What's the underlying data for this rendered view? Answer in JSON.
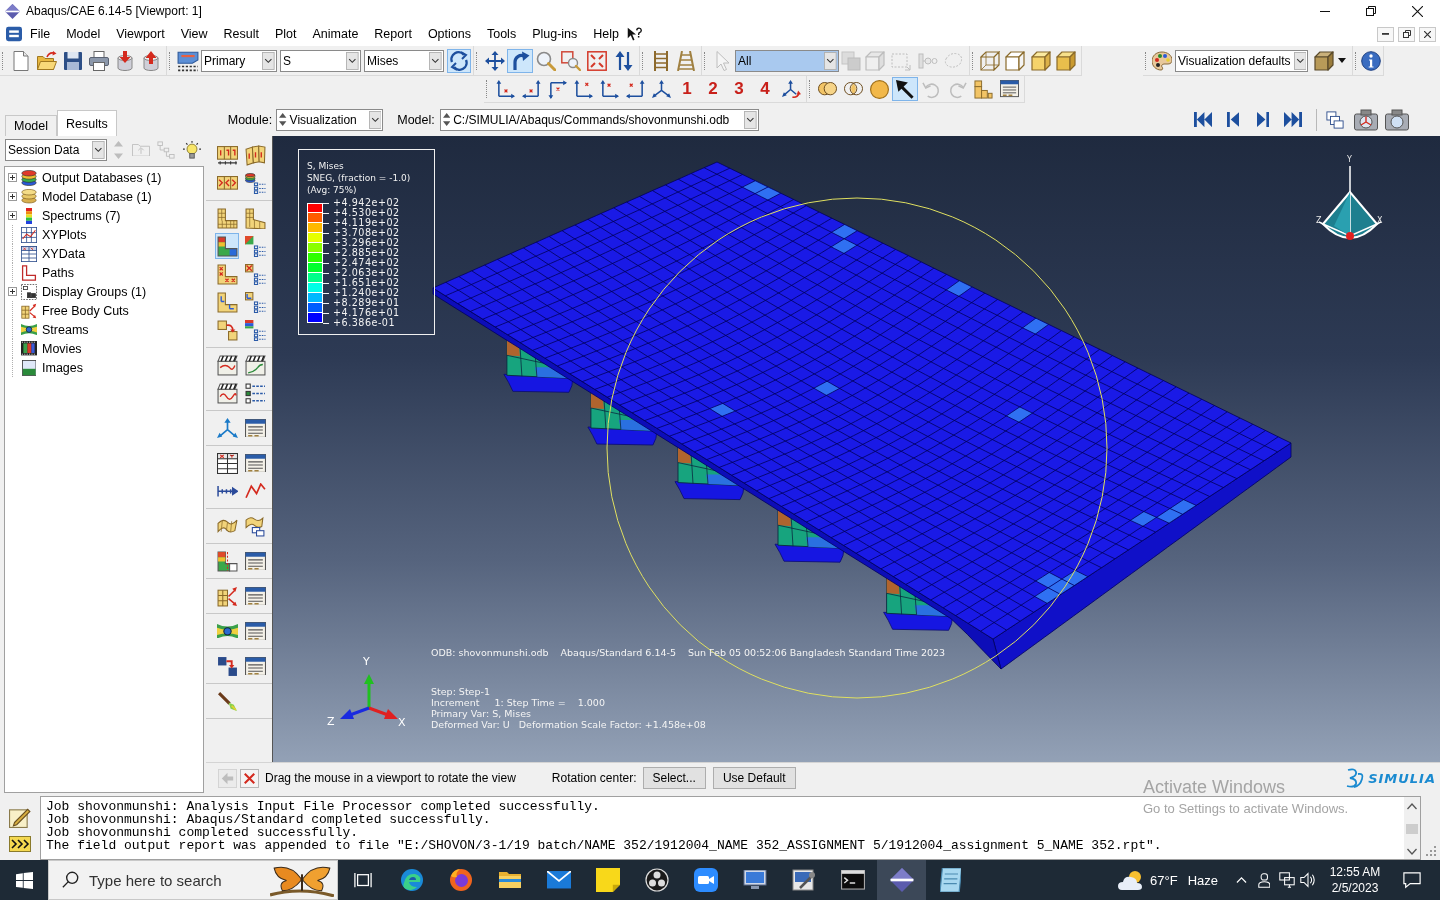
{
  "window": {
    "title": "Abaqus/CAE 6.14-5 [Viewport: 1]"
  },
  "menu": [
    "File",
    "Model",
    "Viewport",
    "View",
    "Result",
    "Plot",
    "Animate",
    "Report",
    "Options",
    "Tools",
    "Plug-ins",
    "Help"
  ],
  "field_output": {
    "variable_type": "Primary",
    "variable": "S",
    "invariant": "Mises",
    "sync_selected": true
  },
  "view_tools": [
    {
      "kind": "pan",
      "selected": false
    },
    {
      "kind": "rotate",
      "selected": true
    },
    {
      "kind": "zoom",
      "selected": false
    },
    {
      "kind": "box-zoom",
      "selected": false
    },
    {
      "kind": "fit",
      "selected": false
    },
    {
      "kind": "flip",
      "selected": false
    }
  ],
  "selection": {
    "filter": "All",
    "tools": [
      {
        "kind": "cursor",
        "disabled": true
      },
      {
        "kind": "stack",
        "disabled": true
      },
      {
        "kind": "cube-select",
        "disabled": true
      },
      {
        "kind": "rect-select",
        "disabled": true
      },
      {
        "kind": "node-select",
        "disabled": true
      },
      {
        "kind": "lasso",
        "disabled": true
      }
    ]
  },
  "display_options": {
    "value": "Visualization defaults"
  },
  "user_views": [
    "1",
    "2",
    "3",
    "4"
  ],
  "display_group_tools": [
    {
      "kind": "union",
      "selected": false,
      "disabled": false
    },
    {
      "kind": "intersect",
      "selected": false,
      "disabled": false
    },
    {
      "kind": "sphere",
      "selected": false,
      "disabled": false
    },
    {
      "kind": "pick-arrow",
      "selected": true,
      "disabled": false
    },
    {
      "kind": "undo",
      "selected": false,
      "disabled": true
    },
    {
      "kind": "redo",
      "selected": false,
      "disabled": true
    },
    {
      "kind": "blocks",
      "selected": false,
      "disabled": false
    },
    {
      "kind": "table-window",
      "selected": false,
      "disabled": false
    }
  ],
  "tabs": [
    {
      "label": "Model",
      "selected": false
    },
    {
      "label": "Results",
      "selected": true
    }
  ],
  "context": {
    "module_label": "Module:",
    "module": "Visualization",
    "model_label": "Model:",
    "model": "C:/SIMULIA/Abaqus/Commands/shovonmunshi.odb"
  },
  "session": {
    "value": "Session Data",
    "tools": [
      {
        "kind": "move-updown",
        "disabled": true
      },
      {
        "kind": "folder-up",
        "disabled": true
      },
      {
        "kind": "tree-nodes",
        "disabled": true
      },
      {
        "kind": "lightbulb",
        "disabled": false
      }
    ]
  },
  "tree": [
    {
      "label": "Output Databases (1)",
      "kind": "odb",
      "expanded": false
    },
    {
      "label": "Model Database (1)",
      "kind": "mdb",
      "expanded": false
    },
    {
      "label": "Spectrums (7)",
      "kind": "spectrum",
      "expanded": false
    },
    {
      "label": "XYPlots",
      "kind": "xyplots"
    },
    {
      "label": "XYData",
      "kind": "xydata"
    },
    {
      "label": "Paths",
      "kind": "paths"
    },
    {
      "label": "Display Groups (1)",
      "kind": "display-groups",
      "expanded": false
    },
    {
      "label": "Free Body Cuts",
      "kind": "free-body"
    },
    {
      "label": "Streams",
      "kind": "streams"
    },
    {
      "label": "Movies",
      "kind": "movies"
    },
    {
      "label": "Images",
      "kind": "images"
    }
  ],
  "toolbox": [
    {
      "tools": [
        {
          "kind": "mesh-numbers",
          "selected": false
        },
        {
          "kind": "numbered-tiles",
          "selected": false
        },
        {
          "kind": "section-arrows",
          "selected": false
        },
        {
          "kind": "layer-options",
          "selected": false
        }
      ]
    },
    {
      "tools": [
        {
          "kind": "undeformed",
          "selected": false
        },
        {
          "kind": "deformed",
          "selected": false
        },
        {
          "kind": "contour",
          "selected": true
        },
        {
          "kind": "contour-options",
          "selected": false
        },
        {
          "kind": "symbol",
          "selected": false
        },
        {
          "kind": "symbol-options",
          "selected": false
        },
        {
          "kind": "orientation",
          "selected": false
        },
        {
          "kind": "orientation-options",
          "selected": false
        },
        {
          "kind": "superimpose",
          "selected": false
        },
        {
          "kind": "superimpose-options",
          "selected": false
        }
      ]
    },
    {
      "tools": [
        {
          "kind": "animate-scale",
          "selected": false
        },
        {
          "kind": "animate-time",
          "selected": false
        },
        {
          "kind": "animate-harmonic",
          "selected": false
        },
        {
          "kind": "animation-options",
          "selected": false
        }
      ]
    },
    {
      "tools": [
        {
          "kind": "triad-axes",
          "selected": false
        },
        {
          "kind": "table-window",
          "selected": false
        }
      ]
    },
    {
      "tools": [
        {
          "kind": "xy-table",
          "selected": false
        },
        {
          "kind": "table-window",
          "selected": false
        },
        {
          "kind": "path-arrow",
          "selected": false
        },
        {
          "kind": "xy-zigzag",
          "selected": false
        }
      ]
    },
    {
      "tools": [
        {
          "kind": "surface-sheet",
          "selected": false
        },
        {
          "kind": "surface-copy",
          "selected": false
        }
      ]
    },
    {
      "tools": [
        {
          "kind": "contour-cut",
          "selected": false
        },
        {
          "kind": "table-window",
          "selected": false
        }
      ]
    },
    {
      "tools": [
        {
          "kind": "free-body",
          "selected": false
        },
        {
          "kind": "table-window",
          "selected": false
        }
      ]
    },
    {
      "tools": [
        {
          "kind": "streams",
          "selected": false
        },
        {
          "kind": "table-window",
          "selected": false
        }
      ]
    },
    {
      "tools": [
        {
          "kind": "swap-boxes",
          "selected": false
        },
        {
          "kind": "table-window",
          "selected": false
        }
      ]
    },
    {
      "tools": [
        {
          "kind": "paint-brush",
          "selected": false
        }
      ]
    }
  ],
  "legend": {
    "lines": [
      "S, Mises",
      "SNEG, (fraction = -1.0)",
      "(Avg: 75%)"
    ],
    "ticks": [
      "+4.942e+02",
      "+4.530e+02",
      "+4.119e+02",
      "+3.708e+02",
      "+3.296e+02",
      "+2.885e+02",
      "+2.474e+02",
      "+2.063e+02",
      "+1.651e+02",
      "+1.240e+02",
      "+8.289e+01",
      "+4.176e+01",
      "+6.386e-01"
    ],
    "bands": [
      {
        "color": "#ff0000"
      },
      {
        "color": "#ff5c00"
      },
      {
        "color": "#ffb900"
      },
      {
        "color": "#e6ff00"
      },
      {
        "color": "#8aff00"
      },
      {
        "color": "#2eff00"
      },
      {
        "color": "#00ff2e"
      },
      {
        "color": "#00ff8a"
      },
      {
        "color": "#00ffe6"
      },
      {
        "color": "#00b9ff"
      },
      {
        "color": "#005cff"
      },
      {
        "color": "#0000ff"
      }
    ]
  },
  "view_cube_labels": {
    "y": "Y",
    "z": "Z",
    "x": "X"
  },
  "info": {
    "header": [
      "ODB: shovonmunshi.odb",
      "Abaqus/Standard 6.14-5",
      "Sun Feb 05 00:52:06 Bangladesh Standard Time 2023"
    ],
    "lines": [
      "Step: Step-1",
      "Increment     1: Step Time =    1.000",
      "Primary Var: S, Mises",
      "Deformed Var: U   Deformation Scale Factor: +1.458e+08"
    ]
  },
  "axis_labels": {
    "y": "Y",
    "z": "Z",
    "x": "X"
  },
  "prompt": {
    "back_disabled": true,
    "message": "Drag the mouse in a viewport to rotate the view",
    "rotation_label": "Rotation center:",
    "buttons": [
      "Select...",
      "Use Default"
    ]
  },
  "brand": "SIMULIA",
  "activation": {
    "title": "Activate Windows",
    "hint": "Go to Settings to activate Windows."
  },
  "messages": [
    "Job shovonmunshi: Analysis Input File Processor completed successfully.",
    "Job shovonmunshi: Abaqus/Standard completed successfully.",
    "Job shovonmunshi completed successfully.",
    "The field output report was appended to file \"E:/SHOVON/3-1/19 batch/NAME 352/1912004_NAME 352_ASSIGNMENT 5/1912004_assignment 5_NAME 352.rpt\"."
  ],
  "taskbar": {
    "search_placeholder": "Type here to search",
    "apps": [
      {
        "kind": "task-view",
        "selected": false
      },
      {
        "kind": "edge",
        "selected": false
      },
      {
        "kind": "firefox",
        "selected": false
      },
      {
        "kind": "explorer",
        "selected": false
      },
      {
        "kind": "mail",
        "selected": false
      },
      {
        "kind": "sticky-notes",
        "selected": false
      },
      {
        "kind": "obs",
        "selected": false
      },
      {
        "kind": "zoom",
        "selected": false
      },
      {
        "kind": "remote-desktop",
        "selected": false
      },
      {
        "kind": "pc-tool",
        "selected": false
      },
      {
        "kind": "terminal",
        "selected": false
      },
      {
        "kind": "abaqus",
        "selected": true
      },
      {
        "kind": "notepad",
        "selected": false
      }
    ],
    "weather": {
      "temperature": "67°F",
      "condition": "Haze"
    },
    "time": "12:55 AM",
    "date": "2/5/2023"
  }
}
